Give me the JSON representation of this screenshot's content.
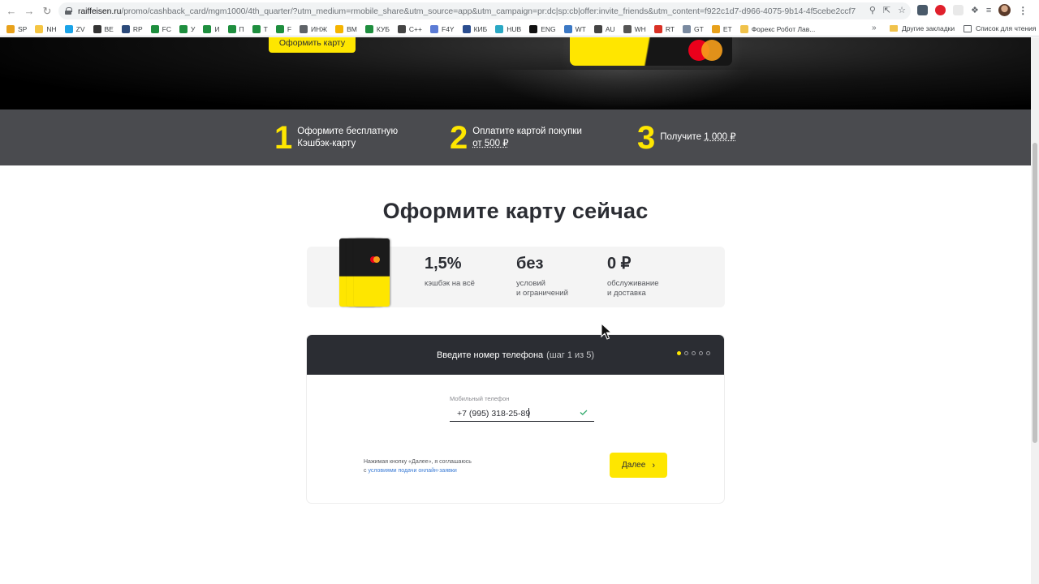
{
  "browser": {
    "url_host": "raiffeisen.ru",
    "url_rest": "/promo/cashback_card/mgm1000/4th_quarter/?utm_medium=rmobile_share&utm_source=app&utm_campaign=pr:dc|sp:cb|offer:invite_friends&utm_content=f922c1d7-d966-4075-9b14-4f5cebe2ccf7",
    "bookmarks": [
      {
        "label": "SP",
        "color": "#e8a11b"
      },
      {
        "label": "NH",
        "color": "#f5c542"
      },
      {
        "label": "ZV",
        "color": "#1aa3e8"
      },
      {
        "label": "BE",
        "color": "#333333"
      },
      {
        "label": "RP",
        "color": "#2c4a7a"
      },
      {
        "label": "FC",
        "color": "#1e8e3e"
      },
      {
        "label": "У",
        "color": "#1e8e3e"
      },
      {
        "label": "И",
        "color": "#1e8e3e"
      },
      {
        "label": "П",
        "color": "#1e8e3e"
      },
      {
        "label": "Т",
        "color": "#1e8e3e"
      },
      {
        "label": "F",
        "color": "#1e8e3e"
      },
      {
        "label": "ИНЖ",
        "color": "#5f6368"
      },
      {
        "label": "BM",
        "color": "#f5b400"
      },
      {
        "label": "КУБ",
        "color": "#1e8e3e"
      },
      {
        "label": "C++",
        "color": "#444444"
      },
      {
        "label": "F4Y",
        "color": "#5b7bd5"
      },
      {
        "label": "КИБ",
        "color": "#2a4d8f"
      },
      {
        "label": "HUB",
        "color": "#2aa8c4"
      },
      {
        "label": "ENG",
        "color": "#111111"
      },
      {
        "label": "WT",
        "color": "#3b78c4"
      },
      {
        "label": "AU",
        "color": "#444444"
      },
      {
        "label": "WH",
        "color": "#555555"
      },
      {
        "label": "RT",
        "color": "#d93025"
      },
      {
        "label": "GT",
        "color": "#7a8aa0"
      },
      {
        "label": "ET",
        "color": "#e8a11b"
      },
      {
        "label": "Форекс Робот Лав...",
        "color": "#f0c24b"
      }
    ],
    "more_label": "»",
    "other_bookmarks": "Другие закладки",
    "reading_list": "Список для чтения"
  },
  "hero": {
    "apply_button": "Оформить карту"
  },
  "steps": [
    {
      "num": "1",
      "line1": "Оформите бесплатную",
      "line2": "Кэшбэк-карту"
    },
    {
      "num": "2",
      "line1": "Оплатите картой покупки",
      "line2": "от 500 ₽"
    },
    {
      "num": "3",
      "line1": "Получите",
      "line2": "1 000 ₽"
    }
  ],
  "section_title": "Оформите карту сейчас",
  "benefits": [
    {
      "big": "1,5%",
      "small1": "кэшбэк на всё",
      "small2": ""
    },
    {
      "big": "без",
      "small1": "условий",
      "small2": "и ограничений"
    },
    {
      "big": "0 ₽",
      "small1": "обслуживание",
      "small2": "и доставка"
    }
  ],
  "form": {
    "title": "Введите номер телефона",
    "step_info": "(шаг 1 из 5)",
    "steps_total": 5,
    "current_step": 1,
    "phone_label": "Мобильный телефон",
    "phone_value": "+7 (995) 318-25-89",
    "consent_line1": "Нажимая кнопку «Далее», я соглашаюсь",
    "consent_line2_prefix": "с ",
    "consent_link": "условиями подачи онлайн-заявки",
    "next_button": "Далее",
    "accent": "#fee600"
  }
}
